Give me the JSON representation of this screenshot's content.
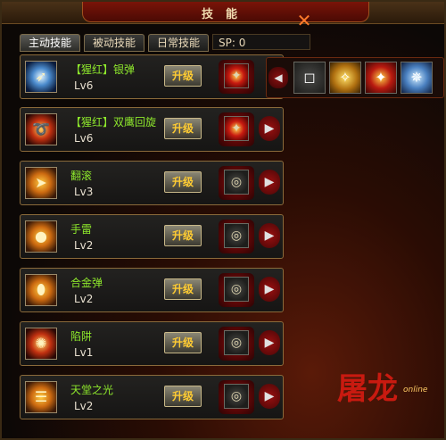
{
  "window": {
    "title": "技能",
    "close_icon": "close-icon"
  },
  "tabs": [
    {
      "label": "主动技能",
      "active": true
    },
    {
      "label": "被动技能",
      "active": false
    },
    {
      "label": "日常技能",
      "active": false
    }
  ],
  "sp_label": "SP: 0",
  "upgrade_label": "升级",
  "skills": [
    {
      "name": "【猩红】银弹",
      "level": "Lv6",
      "icon": "silver-bullet-icon",
      "slot": "crimson-star"
    },
    {
      "name": "【猩红】双鹰回旋",
      "level": "Lv6",
      "icon": "double-eagle-icon",
      "slot": "crimson-star"
    },
    {
      "name": "翻滚",
      "level": "Lv3",
      "icon": "roll-icon",
      "slot": "empty"
    },
    {
      "name": "手雷",
      "level": "Lv2",
      "icon": "grenade-icon",
      "slot": "empty"
    },
    {
      "name": "合金弹",
      "level": "Lv2",
      "icon": "alloy-bullet-icon",
      "slot": "empty"
    },
    {
      "name": "陷阱",
      "level": "Lv1",
      "icon": "trap-icon",
      "slot": "empty"
    },
    {
      "name": "天堂之光",
      "level": "Lv2",
      "icon": "heaven-light-icon",
      "slot": "empty"
    }
  ],
  "expanded_options": [
    {
      "icon": "empty-slot-icon",
      "style": "empty"
    },
    {
      "icon": "gold-rune-icon",
      "style": "gold"
    },
    {
      "icon": "crimson-star-icon",
      "style": "crimson"
    },
    {
      "icon": "blue-compass-icon",
      "style": "blue"
    }
  ],
  "logo": {
    "text": "屠龙",
    "sub": "online"
  }
}
